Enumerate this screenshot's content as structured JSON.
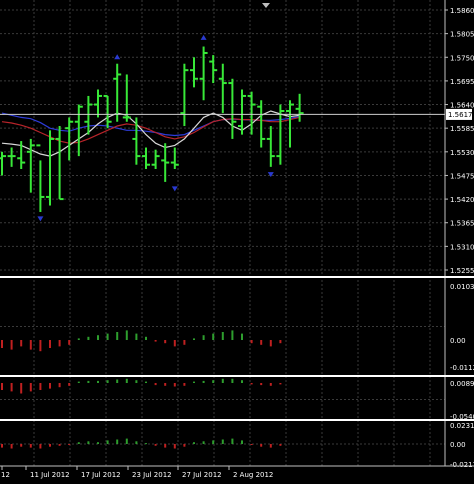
{
  "colors": {
    "background": "#000000",
    "grid": "#3a3a3a",
    "axis_text": "#ffffff",
    "bar": "#38e838",
    "ma_blue": "#2d3bd8",
    "ma_red": "#b8242a",
    "ma_white": "#d8d8d8",
    "fractal": "#2a3ad0",
    "hist_up": "#2e9e2e",
    "hist_down": "#c02020",
    "price_line": "#cfcfcf"
  },
  "main_panel": {
    "price_ticks": [
      "1.5860",
      "1.5805",
      "1.5750",
      "1.5695",
      "1.5640",
      "1.5585",
      "1.5530",
      "1.5475",
      "1.5420",
      "1.5365",
      "1.5310",
      "1.5255"
    ],
    "current_price": "1.5617",
    "top_marker": "scroll-marker-triangle"
  },
  "sub_panels": [
    {
      "ticks": [
        "0.01037",
        "0.00",
        "-0.01128"
      ]
    },
    {
      "ticks": [
        "0.00898",
        "-0.05407"
      ]
    },
    {
      "ticks": [
        "0.02319",
        "0.00",
        "-0.02175"
      ]
    }
  ],
  "time_axis": {
    "labels": [
      "12",
      "11 Jul 2012",
      "17 Jul 2012",
      "23 Jul 2012",
      "27 Jul 2012",
      "2 Aug 2012"
    ]
  },
  "chart_data": {
    "type": "ohlc-bars",
    "series": [
      {
        "open": 1.5515,
        "high": 1.553,
        "low": 1.5475,
        "close": 1.552
      },
      {
        "open": 1.552,
        "high": 1.554,
        "low": 1.5495,
        "close": 1.552
      },
      {
        "open": 1.5515,
        "high": 1.5555,
        "low": 1.549,
        "close": 1.5505
      },
      {
        "open": 1.553,
        "high": 1.556,
        "low": 1.5435,
        "close": 1.5545
      },
      {
        "open": 1.5545,
        "high": 1.551,
        "low": 1.539,
        "close": 1.5425
      },
      {
        "open": 1.5425,
        "high": 1.558,
        "low": 1.5405,
        "close": 1.556
      },
      {
        "open": 1.556,
        "high": 1.559,
        "low": 1.542,
        "close": 1.542
      },
      {
        "open": 1.5585,
        "high": 1.561,
        "low": 1.551,
        "close": 1.56
      },
      {
        "open": 1.56,
        "high": 1.564,
        "low": 1.552,
        "close": 1.5635
      },
      {
        "open": 1.56,
        "high": 1.566,
        "low": 1.557,
        "close": 1.564
      },
      {
        "open": 1.564,
        "high": 1.5675,
        "low": 1.561,
        "close": 1.566
      },
      {
        "open": 1.566,
        "high": 1.566,
        "low": 1.5585,
        "close": 1.56
      },
      {
        "open": 1.57,
        "high": 1.5735,
        "low": 1.56,
        "close": 1.571
      },
      {
        "open": 1.561,
        "high": 1.571,
        "low": 1.56,
        "close": 1.561
      },
      {
        "open": 1.556,
        "high": 1.561,
        "low": 1.55,
        "close": 1.552
      },
      {
        "open": 1.552,
        "high": 1.554,
        "low": 1.549,
        "close": 1.55
      },
      {
        "open": 1.55,
        "high": 1.5535,
        "low": 1.549,
        "close": 1.552
      },
      {
        "open": 1.551,
        "high": 1.555,
        "low": 1.546,
        "close": 1.5505
      },
      {
        "open": 1.5505,
        "high": 1.554,
        "low": 1.549,
        "close": 1.55
      },
      {
        "open": 1.562,
        "high": 1.5735,
        "low": 1.559,
        "close": 1.572
      },
      {
        "open": 1.572,
        "high": 1.575,
        "low": 1.568,
        "close": 1.57
      },
      {
        "open": 1.57,
        "high": 1.5775,
        "low": 1.565,
        "close": 1.576
      },
      {
        "open": 1.574,
        "high": 1.5755,
        "low": 1.569,
        "close": 1.572
      },
      {
        "open": 1.57,
        "high": 1.5735,
        "low": 1.562,
        "close": 1.569
      },
      {
        "open": 1.569,
        "high": 1.57,
        "low": 1.556,
        "close": 1.56
      },
      {
        "open": 1.559,
        "high": 1.5675,
        "low": 1.557,
        "close": 1.566
      },
      {
        "open": 1.566,
        "high": 1.567,
        "low": 1.557,
        "close": 1.564
      },
      {
        "open": 1.5635,
        "high": 1.565,
        "low": 1.554,
        "close": 1.556
      },
      {
        "open": 1.556,
        "high": 1.559,
        "low": 1.5495,
        "close": 1.552
      },
      {
        "open": 1.552,
        "high": 1.564,
        "low": 1.55,
        "close": 1.5625
      },
      {
        "open": 1.5625,
        "high": 1.565,
        "low": 1.554,
        "close": 1.564
      },
      {
        "open": 1.563,
        "high": 1.5665,
        "low": 1.56,
        "close": 1.562
      }
    ],
    "fractals": [
      {
        "bar": 4,
        "price": 1.5375,
        "position": "below"
      },
      {
        "bar": 12,
        "price": 1.575,
        "position": "above"
      },
      {
        "bar": 18,
        "price": 1.5445,
        "position": "below"
      },
      {
        "bar": 21,
        "price": 1.5795,
        "position": "above"
      },
      {
        "bar": 28,
        "price": 1.5478,
        "position": "below"
      }
    ],
    "moving_averages": [
      {
        "color_key": "ma_blue",
        "values": [
          1.562,
          1.5615,
          1.561,
          1.5607,
          1.5598,
          1.5585,
          1.558,
          1.5578,
          1.5585,
          1.559,
          1.5592,
          1.559,
          1.5585,
          1.558,
          1.558,
          1.5578,
          1.5575,
          1.557,
          1.5568,
          1.557,
          1.558,
          1.559,
          1.56,
          1.5605,
          1.5606,
          1.5605,
          1.5604,
          1.5603,
          1.5603,
          1.5605,
          1.5608,
          1.5612
        ]
      },
      {
        "color_key": "ma_red",
        "values": [
          1.56,
          1.5597,
          1.5592,
          1.5585,
          1.5575,
          1.5565,
          1.5555,
          1.555,
          1.5552,
          1.556,
          1.557,
          1.558,
          1.559,
          1.5595,
          1.5592,
          1.5585,
          1.5575,
          1.5565,
          1.556,
          1.5565,
          1.5575,
          1.5588,
          1.56,
          1.5605,
          1.5607,
          1.5605,
          1.5605,
          1.5603,
          1.56,
          1.56,
          1.5605,
          1.561
        ]
      },
      {
        "color_key": "ma_white",
        "values": [
          1.555,
          1.5548,
          1.5545,
          1.5535,
          1.5525,
          1.552,
          1.553,
          1.5545,
          1.556,
          1.5575,
          1.5595,
          1.561,
          1.562,
          1.5615,
          1.5595,
          1.557,
          1.555,
          1.554,
          1.5545,
          1.556,
          1.5585,
          1.561,
          1.562,
          1.561,
          1.559,
          1.558,
          1.5595,
          1.5615,
          1.5625,
          1.5618,
          1.5612,
          1.5615
        ]
      }
    ],
    "sub_panel_1_hist": [
      -0.005,
      -0.006,
      -0.004,
      -0.006,
      -0.007,
      -0.005,
      -0.004,
      -0.003,
      0.001,
      0.002,
      0.003,
      0.004,
      0.005,
      0.006,
      0.004,
      0.002,
      -0.001,
      -0.002,
      -0.004,
      -0.003,
      0.001,
      0.003,
      0.004,
      0.005,
      0.006,
      0.004,
      -0.002,
      -0.003,
      -0.004,
      -0.002,
      0.0,
      0.0
    ],
    "sub_panel_2_hist": [
      -0.01,
      -0.012,
      -0.015,
      -0.012,
      -0.01,
      -0.008,
      -0.006,
      -0.004,
      0.002,
      0.003,
      0.003,
      0.004,
      0.005,
      0.006,
      0.004,
      0.002,
      -0.003,
      -0.004,
      -0.005,
      -0.004,
      0.002,
      0.003,
      0.004,
      0.006,
      0.006,
      0.004,
      -0.002,
      -0.003,
      -0.004,
      -0.002,
      0.0,
      0.0
    ],
    "sub_panel_3_hist": [
      -0.004,
      -0.005,
      -0.003,
      -0.004,
      -0.005,
      -0.003,
      -0.002,
      -0.001,
      0.002,
      0.003,
      0.002,
      0.004,
      0.005,
      0.006,
      0.003,
      0.001,
      -0.002,
      -0.004,
      -0.005,
      -0.003,
      0.002,
      0.003,
      0.004,
      0.005,
      0.006,
      0.004,
      -0.001,
      -0.003,
      -0.004,
      -0.002,
      0.0,
      0.0
    ]
  }
}
